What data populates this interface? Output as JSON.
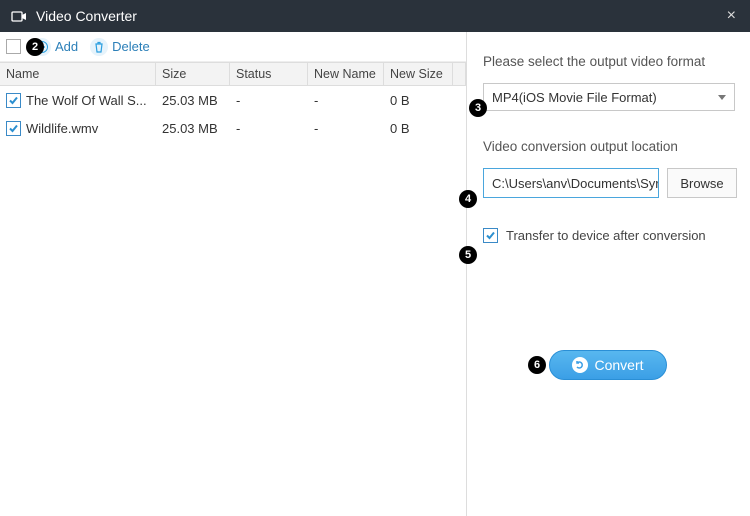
{
  "window": {
    "title": "Video Converter",
    "close_glyph": "×"
  },
  "toolbar": {
    "add_label": "Add",
    "delete_label": "Delete"
  },
  "columns": {
    "name": "Name",
    "size": "Size",
    "status": "Status",
    "newname": "New Name",
    "newsize": "New Size"
  },
  "rows": [
    {
      "name": "The Wolf Of Wall S...",
      "size": "25.03 MB",
      "status": "-",
      "newname": "-",
      "newsize": "0 B",
      "checked": true
    },
    {
      "name": "Wildlife.wmv",
      "size": "25.03 MB",
      "status": "-",
      "newname": "-",
      "newsize": "0 B",
      "checked": true
    }
  ],
  "right": {
    "format_label": "Please select the output video format",
    "format_value": "MP4(iOS Movie File Format)",
    "location_label": "Video conversion output location",
    "location_value": "C:\\Users\\anv\\Documents\\Syr",
    "browse_label": "Browse",
    "transfer_label": "Transfer to device after conversion",
    "transfer_checked": true,
    "convert_label": "Convert"
  },
  "steps": {
    "s2": "2",
    "s3": "3",
    "s4": "4",
    "s5": "5",
    "s6": "6"
  }
}
